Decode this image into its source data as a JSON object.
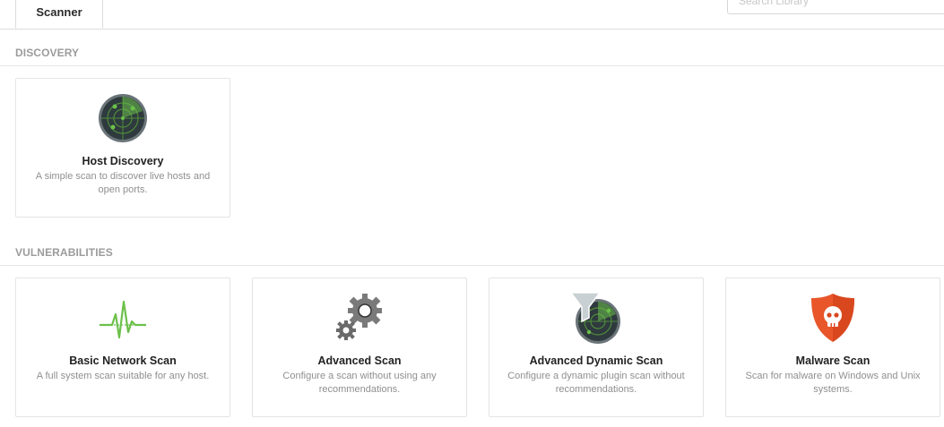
{
  "tabs": [
    {
      "label": "Scanner"
    }
  ],
  "search": {
    "placeholder": "Search Library"
  },
  "sections": {
    "discovery": {
      "title": "DISCOVERY",
      "cards": [
        {
          "icon": "radar-icon",
          "title": "Host Discovery",
          "description": "A simple scan to discover live hosts and open ports."
        }
      ]
    },
    "vulnerabilities": {
      "title": "VULNERABILITIES",
      "cards": [
        {
          "icon": "pulse-icon",
          "title": "Basic Network Scan",
          "description": "A full system scan suitable for any host."
        },
        {
          "icon": "gears-icon",
          "title": "Advanced Scan",
          "description": "Configure a scan without using any recommendations."
        },
        {
          "icon": "funnel-radar-icon",
          "title": "Advanced Dynamic Scan",
          "description": "Configure a dynamic plugin scan without recommendations."
        },
        {
          "icon": "skull-shield-icon",
          "title": "Malware Scan",
          "description": "Scan for malware on Windows and Unix systems."
        }
      ]
    }
  },
  "colors": {
    "radar_dark": "#2e3a3e",
    "radar_green": "#6cc04a",
    "gear_gray": "#7a7a7a",
    "malware_orange": "#e8562a"
  }
}
